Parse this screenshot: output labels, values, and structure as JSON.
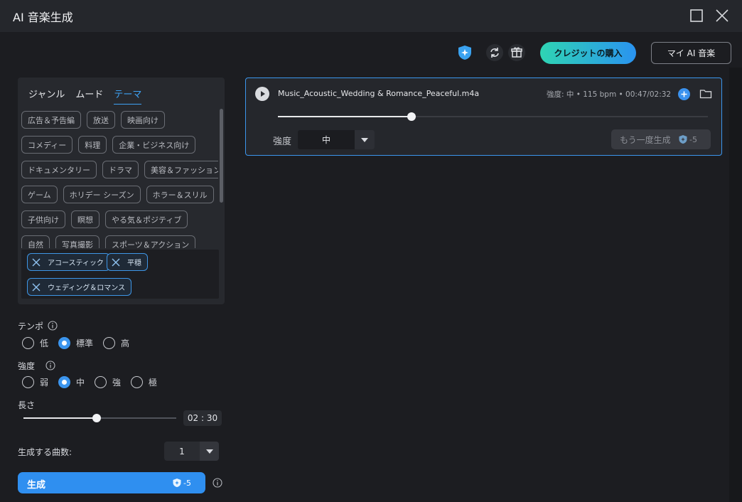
{
  "app": {
    "title": "AI 音楽生成"
  },
  "header": {
    "credit_button": "クレジットの購入",
    "my_music_button": "マイ AI 音楽"
  },
  "filters": {
    "tabs": [
      {
        "label": "ジャンル",
        "active": false
      },
      {
        "label": "ムード",
        "active": false
      },
      {
        "label": "テーマ",
        "active": true
      }
    ],
    "theme_tags": [
      [
        "広告＆予告編",
        "放送",
        "映画向け"
      ],
      [
        "コメディー",
        "料理",
        "企業・ビジネス向け"
      ],
      [
        "ドキュメンタリー",
        "ドラマ",
        "美容＆ファッション"
      ],
      [
        "ゲーム",
        "ホリデー シーズン",
        "ホラー＆スリル"
      ],
      [
        "子供向け",
        "瞑想",
        "やる気＆ポジティブ"
      ],
      [
        "自然",
        "写真撮影",
        "スポーツ＆アクション"
      ]
    ],
    "selected_tags": [
      "アコースティック",
      "平穏",
      "ウェディング＆ロマンス"
    ]
  },
  "tempo": {
    "label": "テンポ",
    "options": [
      "低",
      "標準",
      "高"
    ],
    "selected": "標準"
  },
  "intensity": {
    "label": "強度",
    "options": [
      "弱",
      "中",
      "強",
      "極"
    ],
    "selected": "中"
  },
  "length": {
    "label": "長さ",
    "value": "02 : 30",
    "slider_fraction": 0.48
  },
  "song_count": {
    "label": "生成する曲数:",
    "value": "1"
  },
  "generate": {
    "label": "生成",
    "cost": "-5"
  },
  "track": {
    "filename": "Music_Acoustic_Wedding & Romance_Peaceful.m4a",
    "meta": "強度: 中 • 115 bpm • 00:47/02:32",
    "progress_fraction": 0.31,
    "intensity_label": "強度",
    "intensity_value": "中",
    "regenerate_label": "もう一度生成",
    "regenerate_cost": "-5"
  },
  "colors": {
    "accent": "#3b95ee",
    "background": "#1c1d21",
    "panel": "#27292e"
  }
}
